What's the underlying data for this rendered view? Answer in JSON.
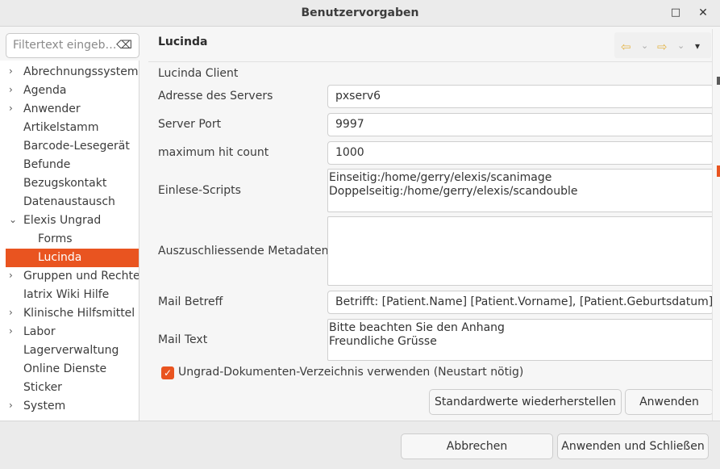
{
  "window": {
    "title": "Benutzervorgaben",
    "maximize_icon": "□",
    "close_icon": "✕"
  },
  "filter": {
    "placeholder": "Filtertext eingeb…",
    "clear_icon": "⌫"
  },
  "tree": {
    "items": [
      {
        "label": "Abrechnungssysteme",
        "expandable": true,
        "expanded": false,
        "level": 0
      },
      {
        "label": "Agenda",
        "expandable": true,
        "expanded": false,
        "level": 0
      },
      {
        "label": "Anwender",
        "expandable": true,
        "expanded": false,
        "level": 0
      },
      {
        "label": "Artikelstamm",
        "expandable": false,
        "level": 0
      },
      {
        "label": "Barcode-Lesegerät",
        "expandable": false,
        "level": 0
      },
      {
        "label": "Befunde",
        "expandable": false,
        "level": 0
      },
      {
        "label": "Bezugskontakt",
        "expandable": false,
        "level": 0
      },
      {
        "label": "Datenaustausch",
        "expandable": false,
        "level": 0
      },
      {
        "label": "Elexis Ungrad",
        "expandable": true,
        "expanded": true,
        "level": 0
      },
      {
        "label": "Forms",
        "expandable": false,
        "level": 1
      },
      {
        "label": "Lucinda",
        "expandable": false,
        "level": 1,
        "selected": true
      },
      {
        "label": "Gruppen und Rechte",
        "expandable": true,
        "expanded": false,
        "level": 0
      },
      {
        "label": "Iatrix Wiki Hilfe",
        "expandable": false,
        "level": 0
      },
      {
        "label": "Klinische Hilfsmittel",
        "expandable": true,
        "expanded": false,
        "level": 0
      },
      {
        "label": "Labor",
        "expandable": true,
        "expanded": false,
        "level": 0
      },
      {
        "label": "Lagerverwaltung",
        "expandable": false,
        "level": 0
      },
      {
        "label": "Online Dienste",
        "expandable": false,
        "level": 0
      },
      {
        "label": "Sticker",
        "expandable": false,
        "level": 0
      },
      {
        "label": "System",
        "expandable": true,
        "expanded": false,
        "level": 0
      }
    ],
    "arrow_collapsed": "›",
    "arrow_expanded": "⌄"
  },
  "page": {
    "title": "Lucinda",
    "nav": {
      "back_icon": "⇦",
      "forward_icon": "⇨",
      "dropdown_icon": "⌄",
      "menu_icon": "▾"
    },
    "section_label": "Lucinda Client",
    "server_address": {
      "label": "Adresse des Servers",
      "value": "pxserv6"
    },
    "server_port": {
      "label": "Server Port",
      "value": "9997"
    },
    "max_hit_count": {
      "label": "maximum hit count",
      "value": "1000"
    },
    "scan_scripts": {
      "label": "Einlese-Scripts",
      "lines": [
        "Einseitig:/home/gerry/elexis/scanimage",
        "Doppelseitig:/home/gerry/elexis/scandouble"
      ]
    },
    "excluded_metadata": {
      "label": "Auszuschliessende Metadaten",
      "lines": []
    },
    "mail_subject": {
      "label": "Mail Betreff",
      "value": "Betrifft: [Patient.Name]  [Patient.Vorname], [Patient.Geburtsdatum]"
    },
    "mail_text": {
      "label": "Mail Text",
      "lines": [
        "Bitte beachten Sie den Anhang",
        "Freundliche Grüsse"
      ]
    },
    "use_ungrad_dir": {
      "label": "Ungrad-Dokumenten-Verzeichnis verwenden (Neustart nötig)",
      "checked": true,
      "check_icon": "✓"
    },
    "restore_defaults_label": "Standardwerte wiederherstellen",
    "apply_label": "Anwenden"
  },
  "footer": {
    "cancel_label": "Abbrechen",
    "apply_close_label": "Anwenden und Schließen"
  },
  "colors": {
    "accent": "#e95420",
    "nav_arrow": "#e4b64c"
  }
}
